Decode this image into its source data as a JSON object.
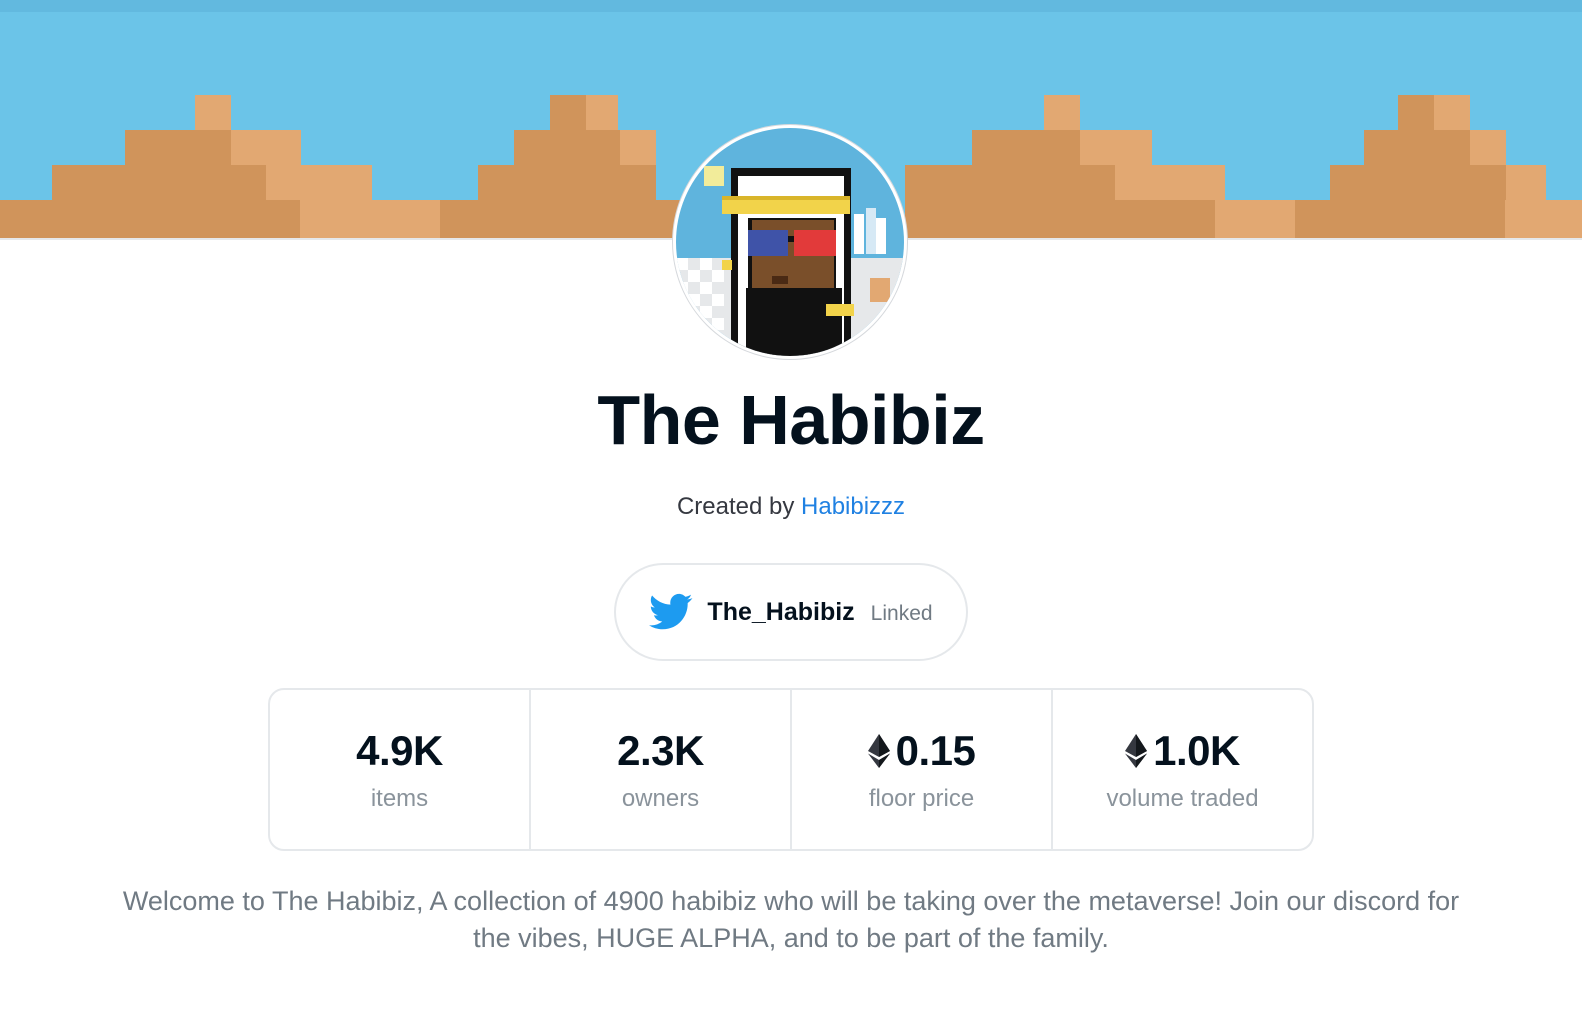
{
  "collection": {
    "title": "The Habibiz",
    "created_by_prefix": "Created by",
    "creator": "Habibizzz",
    "social": {
      "icon": "twitter-icon",
      "handle": "The_Habibiz",
      "status": "Linked"
    },
    "stats": [
      {
        "value": "4.9K",
        "label": "items",
        "eth": false
      },
      {
        "value": "2.3K",
        "label": "owners",
        "eth": false
      },
      {
        "value": "0.15",
        "label": "floor price",
        "eth": true
      },
      {
        "value": "1.0K",
        "label": "volume traded",
        "eth": true
      }
    ],
    "description": "Welcome to The Habibiz, A collection of 4900 habibiz who will be taking over the metaverse! Join our discord for the vibes, HUGE ALPHA, and to be part of the family."
  },
  "colors": {
    "sky": "#6bc4e8",
    "sand_dark": "#d0945b",
    "sand_light": "#e2a872",
    "link": "#2081e2",
    "text_primary": "#04111d",
    "text_secondary": "#707a83"
  }
}
